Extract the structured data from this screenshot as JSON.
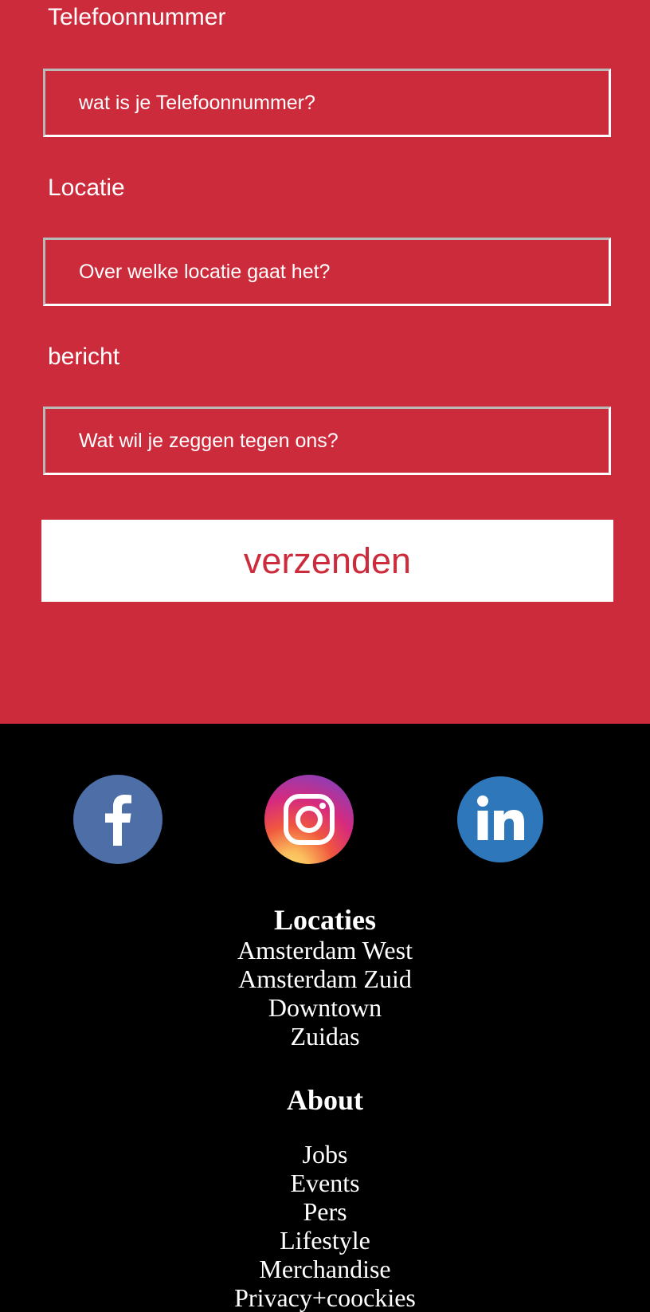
{
  "form": {
    "phone": {
      "label": "Telefoonnummer",
      "placeholder": "wat is je Telefoonnummer?"
    },
    "location": {
      "label": "Locatie",
      "placeholder": "Over welke locatie gaat het?"
    },
    "message": {
      "label": "bericht",
      "placeholder": "Wat wil je zeggen tegen ons?"
    },
    "submit_label": "verzenden"
  },
  "social": [
    {
      "name": "facebook-icon"
    },
    {
      "name": "instagram-icon"
    },
    {
      "name": "linkedin-icon"
    }
  ],
  "footer": {
    "locations": {
      "heading": "Locaties",
      "items": [
        "Amsterdam West",
        "Amsterdam Zuid",
        "Downtown",
        "Zuidas"
      ]
    },
    "about": {
      "heading": "About",
      "items": [
        "Jobs",
        "Events",
        "Pers",
        "Lifestyle",
        "Merchandise",
        "Privacy+coockies"
      ]
    }
  },
  "colors": {
    "form_background": "#cc2b3b",
    "footer_background": "#000000",
    "button_text": "#cc2b3b",
    "facebook": "#4e6ea8",
    "linkedin": "#2e77bb"
  }
}
